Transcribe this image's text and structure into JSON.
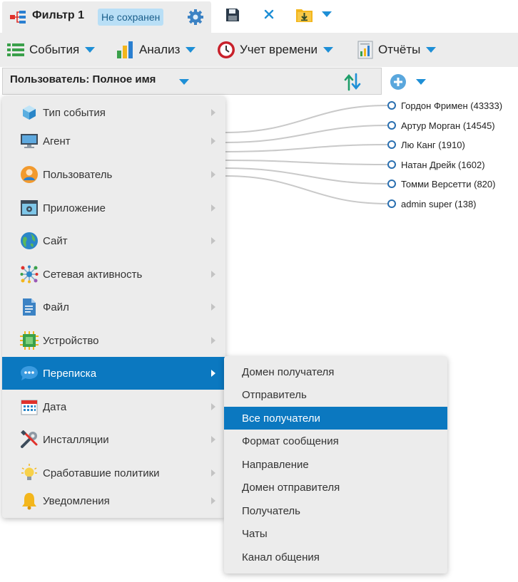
{
  "tab": {
    "title": "Фильтр 1",
    "status_badge": "Не сохранен"
  },
  "menubar": {
    "items": [
      {
        "label": "События",
        "icon": "list-icon"
      },
      {
        "label": "Анализ",
        "icon": "bar-chart-icon"
      },
      {
        "label": "Учет времени",
        "icon": "clock-icon"
      },
      {
        "label": "Отчёты",
        "icon": "report-icon"
      }
    ]
  },
  "field_selector": {
    "label": "Пользователь: Полное имя"
  },
  "tree": {
    "nodes": [
      {
        "label": "Гордон Фримен (43333)"
      },
      {
        "label": "Артур Морган (14545)"
      },
      {
        "label": "Лю Канг (1910)"
      },
      {
        "label": "Натан Дрейк (1602)"
      },
      {
        "label": "Томми Версетти (820)"
      },
      {
        "label": "admin super (138)"
      }
    ]
  },
  "menu": {
    "items": [
      {
        "label": "Тип события",
        "icon": "cube-icon"
      },
      {
        "label": "Агент",
        "icon": "monitor-icon"
      },
      {
        "label": "Пользователь",
        "icon": "user-icon"
      },
      {
        "label": "Приложение",
        "icon": "app-window-icon"
      },
      {
        "label": "Сайт",
        "icon": "globe-icon"
      },
      {
        "label": "Сетевая активность",
        "icon": "network-icon"
      },
      {
        "label": "Файл",
        "icon": "document-icon"
      },
      {
        "label": "Устройство",
        "icon": "chip-icon"
      },
      {
        "label": "Переписка",
        "icon": "chat-icon",
        "active": true
      },
      {
        "label": "Дата",
        "icon": "calendar-icon"
      },
      {
        "label": "Инсталляции",
        "icon": "tools-icon"
      },
      {
        "label": "Сработавшие политики",
        "icon": "lightbulb-icon"
      },
      {
        "label": "Уведомления",
        "icon": "bell-icon"
      }
    ]
  },
  "submenu": {
    "items": [
      {
        "label": "Домен получателя"
      },
      {
        "label": "Отправитель"
      },
      {
        "label": "Все получатели",
        "active": true
      },
      {
        "label": "Формат сообщения"
      },
      {
        "label": "Направление"
      },
      {
        "label": "Домен отправителя"
      },
      {
        "label": "Получатель"
      },
      {
        "label": "Чаты"
      },
      {
        "label": "Канал общения"
      }
    ]
  },
  "colors": {
    "accent": "#0b78c0",
    "caret": "#1e8fd6",
    "badge_bg": "#b9dff6"
  }
}
